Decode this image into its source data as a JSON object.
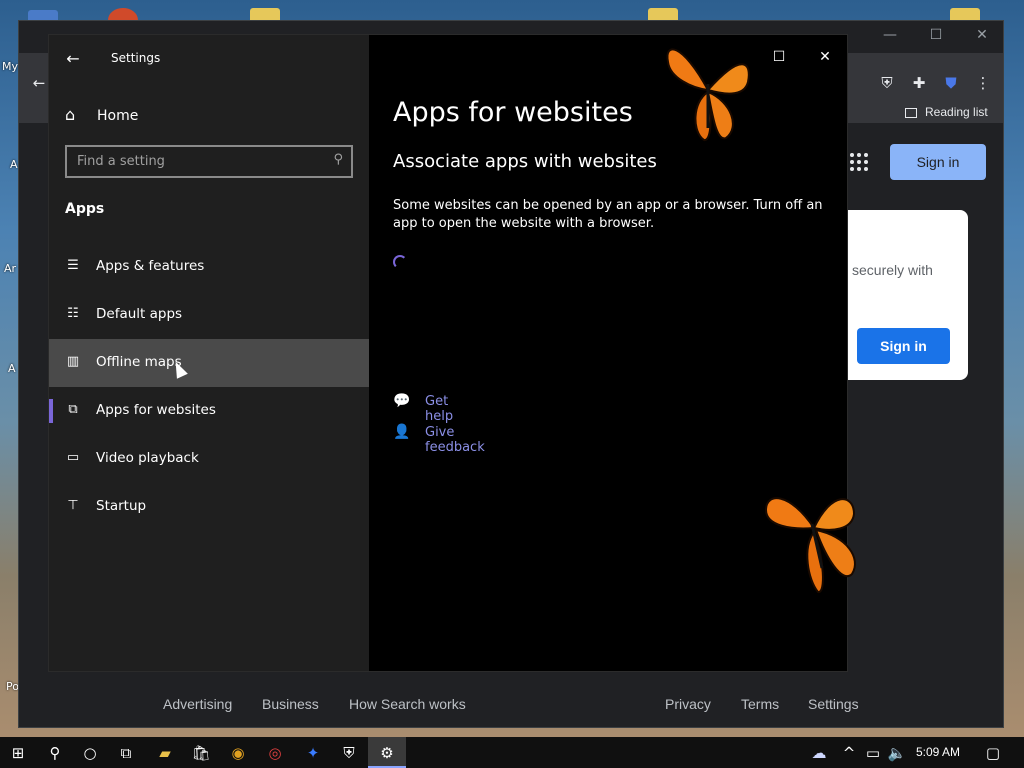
{
  "desktop": {
    "labels": [
      "My",
      "A",
      "Ar",
      "A",
      "Po"
    ]
  },
  "chrome": {
    "reading_list": "Reading list",
    "sign_in_top": "Sign in",
    "card_text": "securely with",
    "card_sign_in": "Sign in",
    "footer_links": [
      "Advertising",
      "Business",
      "How Search works",
      "Privacy",
      "Terms",
      "Settings"
    ]
  },
  "settings": {
    "window_title": "Settings",
    "home_label": "Home",
    "search_placeholder": "Find a setting",
    "section_header": "Apps",
    "nav_items": [
      {
        "label": "Apps & features",
        "icon": "list-icon"
      },
      {
        "label": "Default apps",
        "icon": "default-apps-icon"
      },
      {
        "label": "Offline maps",
        "icon": "map-icon",
        "state": "hover"
      },
      {
        "label": "Apps for websites",
        "icon": "app-link-icon",
        "state": "selected"
      },
      {
        "label": "Video playback",
        "icon": "video-icon"
      },
      {
        "label": "Startup",
        "icon": "startup-icon"
      }
    ],
    "page_title": "Apps for websites",
    "sub_title": "Associate apps with websites",
    "description": "Some websites can be opened by an app or a browser.  Turn off an app to open the website with a browser.",
    "links": {
      "help": "Get help",
      "feedback": "Give feedback"
    },
    "accent_color": "#7a66d8",
    "link_color": "#8b8fe6"
  },
  "taskbar": {
    "clock": "5:09 AM"
  }
}
